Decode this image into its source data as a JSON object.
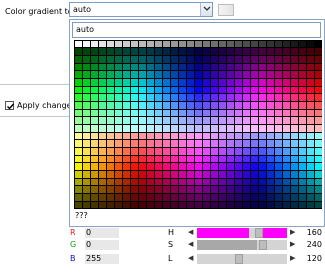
{
  "header": {
    "label": "Color gradient to",
    "value": "auto"
  },
  "popup": {
    "search_value": "auto",
    "hex_value": "???",
    "grid": {
      "rows": 22,
      "cols": 31
    }
  },
  "apply": {
    "label": "Apply changes",
    "checked": true
  },
  "rgb": [
    {
      "label": "R",
      "value": "0",
      "color": "#e02020"
    },
    {
      "label": "G",
      "value": "0",
      "color": "#10a010"
    },
    {
      "label": "B",
      "value": "255",
      "color": "#1010c0"
    }
  ],
  "hsl": [
    {
      "label": "H",
      "value": "160",
      "fill": "#ff00ff"
    },
    {
      "label": "S",
      "value": "240",
      "fill": "#a8a8a8"
    },
    {
      "label": "L",
      "value": "120",
      "fill": "#a8a8a8"
    }
  ]
}
